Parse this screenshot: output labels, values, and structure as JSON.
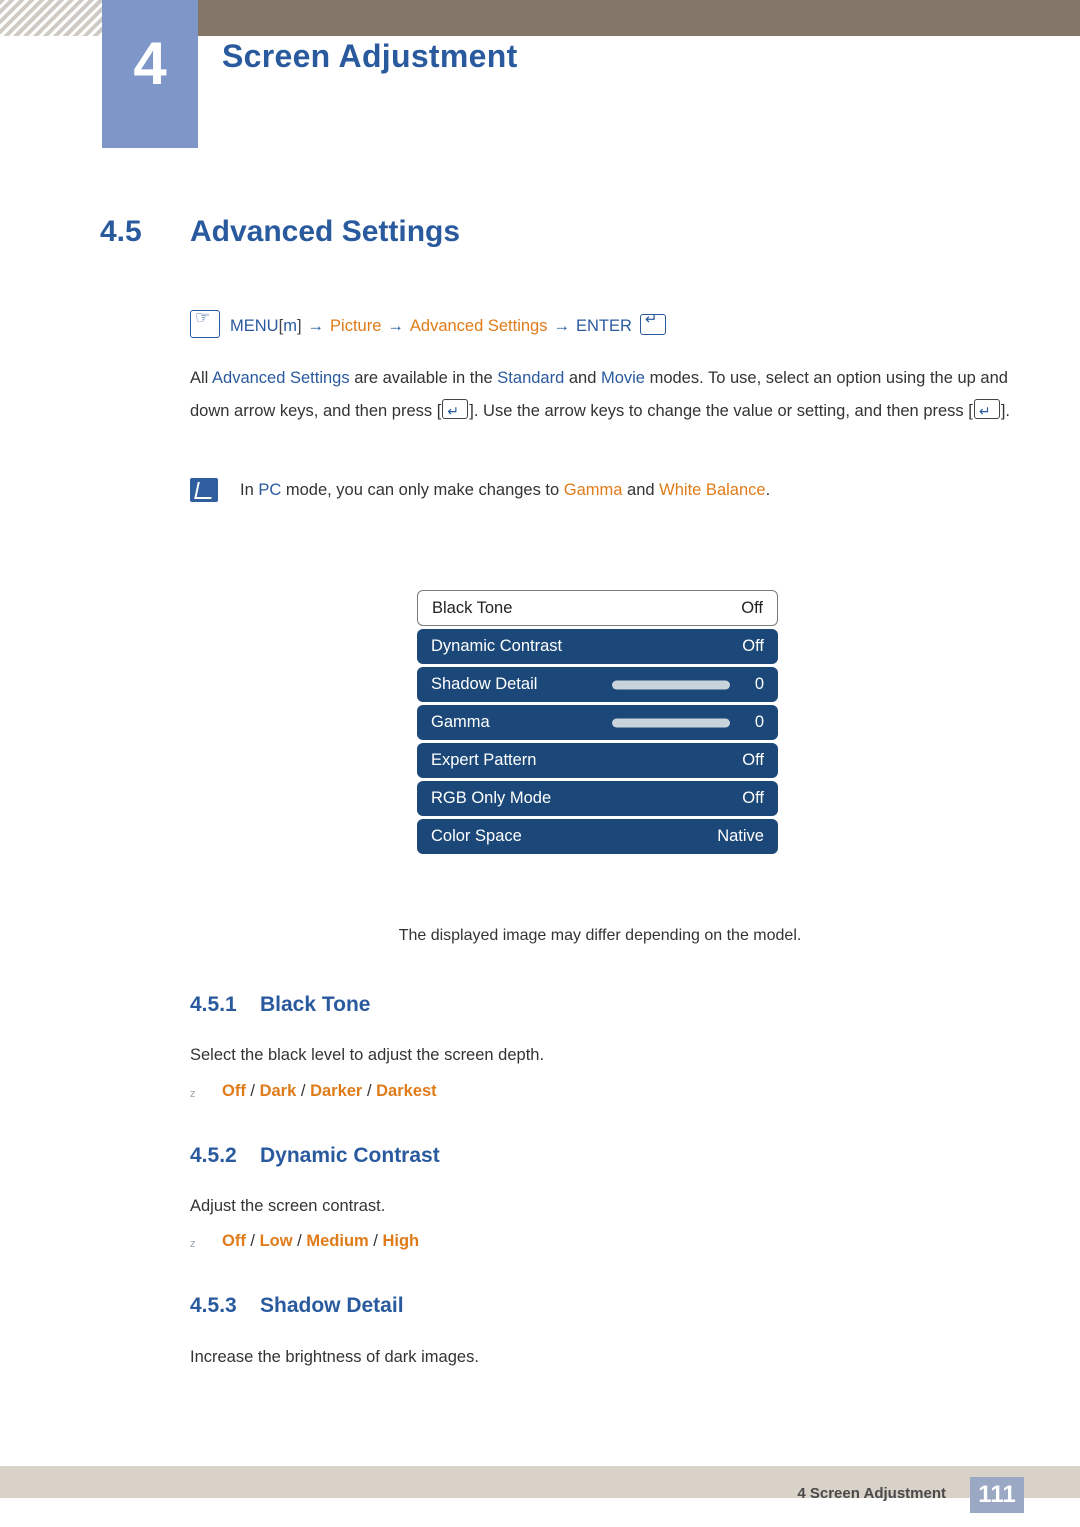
{
  "header": {
    "chapter_number": "4",
    "chapter_title": "Screen Adjustment"
  },
  "section": {
    "number": "4.5",
    "title": "Advanced Settings"
  },
  "menu_path": {
    "menu_label": "MENU",
    "bracket_open": "[",
    "key_glyph": "m",
    "bracket_close": "]",
    "arrow": "→",
    "step1": "Picture",
    "step2": "Advanced Settings",
    "enter_label": "ENTER"
  },
  "paragraph": {
    "t1": "All ",
    "t2": "Advanced Settings",
    "t3": " are available in the ",
    "t4": "Standard",
    "t5": " and ",
    "t6": "Movie",
    "t7": " modes. To use, select an option using the up and down arrow keys, and then press [",
    "t8": "]. Use the arrow keys to change the value or setting, and then press [",
    "t9": "]."
  },
  "note": {
    "t1": "In ",
    "t2": "PC",
    "t3": " mode, you can only make changes to ",
    "t4": "Gamma",
    "t5": " and ",
    "t6": "White Balance",
    "t7": "."
  },
  "osd": {
    "rows": [
      {
        "label": "Black Tone",
        "value": "Off",
        "slider": false
      },
      {
        "label": "Dynamic Contrast",
        "value": "Off",
        "slider": false
      },
      {
        "label": "Shadow Detail",
        "value": "0",
        "slider": true
      },
      {
        "label": "Gamma",
        "value": "0",
        "slider": true
      },
      {
        "label": "Expert Pattern",
        "value": "Off",
        "slider": false
      },
      {
        "label": "RGB Only Mode",
        "value": "Off",
        "slider": false
      },
      {
        "label": "Color Space",
        "value": "Native",
        "slider": false
      }
    ],
    "caption": "The displayed image may differ depending on the model."
  },
  "subsections": [
    {
      "number": "4.5.1",
      "title": "Black Tone",
      "body": "Select the black level to adjust the screen depth.",
      "options": [
        "Off",
        "Dark",
        "Darker",
        "Darkest"
      ]
    },
    {
      "number": "4.5.2",
      "title": "Dynamic Contrast",
      "body": "Adjust the screen contrast.",
      "options": [
        "Off",
        "Low",
        "Medium",
        "High"
      ]
    },
    {
      "number": "4.5.3",
      "title": "Shadow Detail",
      "body": "Increase the brightness of dark images.",
      "options": []
    }
  ],
  "footer": {
    "text": "4 Screen Adjustment",
    "page": "111"
  }
}
